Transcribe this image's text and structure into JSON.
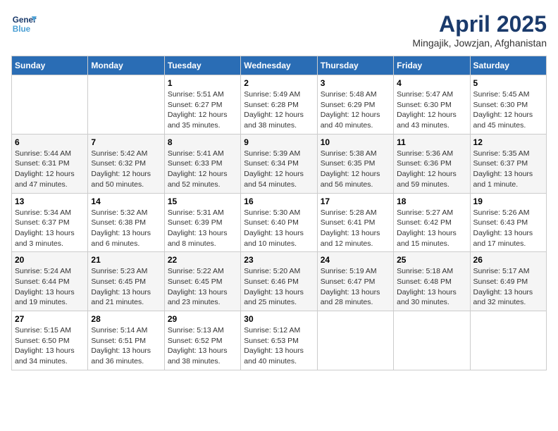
{
  "header": {
    "logo_line1": "General",
    "logo_line2": "Blue",
    "title": "April 2025",
    "subtitle": "Mingajik, Jowzjan, Afghanistan"
  },
  "days_of_week": [
    "Sunday",
    "Monday",
    "Tuesday",
    "Wednesday",
    "Thursday",
    "Friday",
    "Saturday"
  ],
  "weeks": [
    [
      {
        "day": "",
        "empty": true
      },
      {
        "day": "",
        "empty": true
      },
      {
        "day": "1",
        "sunrise": "5:51 AM",
        "sunset": "6:27 PM",
        "daylight": "12 hours and 35 minutes."
      },
      {
        "day": "2",
        "sunrise": "5:49 AM",
        "sunset": "6:28 PM",
        "daylight": "12 hours and 38 minutes."
      },
      {
        "day": "3",
        "sunrise": "5:48 AM",
        "sunset": "6:29 PM",
        "daylight": "12 hours and 40 minutes."
      },
      {
        "day": "4",
        "sunrise": "5:47 AM",
        "sunset": "6:30 PM",
        "daylight": "12 hours and 43 minutes."
      },
      {
        "day": "5",
        "sunrise": "5:45 AM",
        "sunset": "6:30 PM",
        "daylight": "12 hours and 45 minutes."
      }
    ],
    [
      {
        "day": "6",
        "sunrise": "5:44 AM",
        "sunset": "6:31 PM",
        "daylight": "12 hours and 47 minutes."
      },
      {
        "day": "7",
        "sunrise": "5:42 AM",
        "sunset": "6:32 PM",
        "daylight": "12 hours and 50 minutes."
      },
      {
        "day": "8",
        "sunrise": "5:41 AM",
        "sunset": "6:33 PM",
        "daylight": "12 hours and 52 minutes."
      },
      {
        "day": "9",
        "sunrise": "5:39 AM",
        "sunset": "6:34 PM",
        "daylight": "12 hours and 54 minutes."
      },
      {
        "day": "10",
        "sunrise": "5:38 AM",
        "sunset": "6:35 PM",
        "daylight": "12 hours and 56 minutes."
      },
      {
        "day": "11",
        "sunrise": "5:36 AM",
        "sunset": "6:36 PM",
        "daylight": "12 hours and 59 minutes."
      },
      {
        "day": "12",
        "sunrise": "5:35 AM",
        "sunset": "6:37 PM",
        "daylight": "13 hours and 1 minute."
      }
    ],
    [
      {
        "day": "13",
        "sunrise": "5:34 AM",
        "sunset": "6:37 PM",
        "daylight": "13 hours and 3 minutes."
      },
      {
        "day": "14",
        "sunrise": "5:32 AM",
        "sunset": "6:38 PM",
        "daylight": "13 hours and 6 minutes."
      },
      {
        "day": "15",
        "sunrise": "5:31 AM",
        "sunset": "6:39 PM",
        "daylight": "13 hours and 8 minutes."
      },
      {
        "day": "16",
        "sunrise": "5:30 AM",
        "sunset": "6:40 PM",
        "daylight": "13 hours and 10 minutes."
      },
      {
        "day": "17",
        "sunrise": "5:28 AM",
        "sunset": "6:41 PM",
        "daylight": "13 hours and 12 minutes."
      },
      {
        "day": "18",
        "sunrise": "5:27 AM",
        "sunset": "6:42 PM",
        "daylight": "13 hours and 15 minutes."
      },
      {
        "day": "19",
        "sunrise": "5:26 AM",
        "sunset": "6:43 PM",
        "daylight": "13 hours and 17 minutes."
      }
    ],
    [
      {
        "day": "20",
        "sunrise": "5:24 AM",
        "sunset": "6:44 PM",
        "daylight": "13 hours and 19 minutes."
      },
      {
        "day": "21",
        "sunrise": "5:23 AM",
        "sunset": "6:45 PM",
        "daylight": "13 hours and 21 minutes."
      },
      {
        "day": "22",
        "sunrise": "5:22 AM",
        "sunset": "6:45 PM",
        "daylight": "13 hours and 23 minutes."
      },
      {
        "day": "23",
        "sunrise": "5:20 AM",
        "sunset": "6:46 PM",
        "daylight": "13 hours and 25 minutes."
      },
      {
        "day": "24",
        "sunrise": "5:19 AM",
        "sunset": "6:47 PM",
        "daylight": "13 hours and 28 minutes."
      },
      {
        "day": "25",
        "sunrise": "5:18 AM",
        "sunset": "6:48 PM",
        "daylight": "13 hours and 30 minutes."
      },
      {
        "day": "26",
        "sunrise": "5:17 AM",
        "sunset": "6:49 PM",
        "daylight": "13 hours and 32 minutes."
      }
    ],
    [
      {
        "day": "27",
        "sunrise": "5:15 AM",
        "sunset": "6:50 PM",
        "daylight": "13 hours and 34 minutes."
      },
      {
        "day": "28",
        "sunrise": "5:14 AM",
        "sunset": "6:51 PM",
        "daylight": "13 hours and 36 minutes."
      },
      {
        "day": "29",
        "sunrise": "5:13 AM",
        "sunset": "6:52 PM",
        "daylight": "13 hours and 38 minutes."
      },
      {
        "day": "30",
        "sunrise": "5:12 AM",
        "sunset": "6:53 PM",
        "daylight": "13 hours and 40 minutes."
      },
      {
        "day": "",
        "empty": true
      },
      {
        "day": "",
        "empty": true
      },
      {
        "day": "",
        "empty": true
      }
    ]
  ],
  "daylight_label": "Daylight:"
}
